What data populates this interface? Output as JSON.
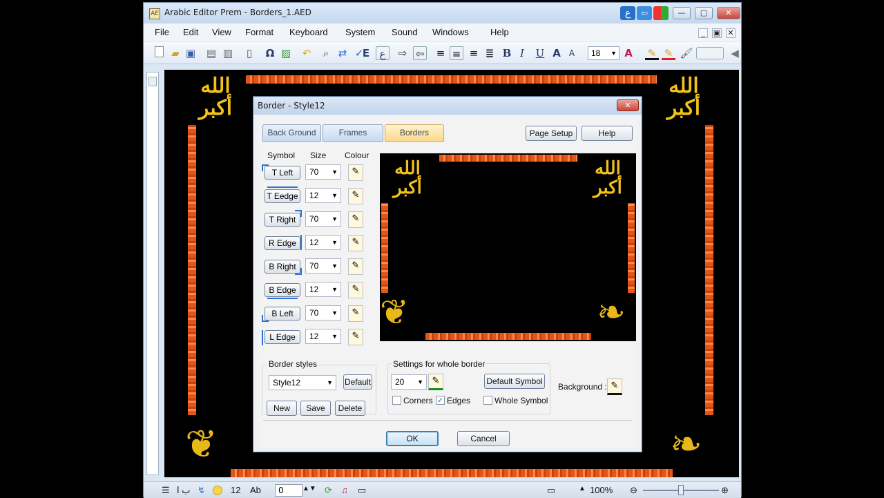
{
  "window": {
    "title": "Arabic Editor Prem - Borders_1.AED",
    "arabic_btn": "ع",
    "minimize": "—",
    "maximize": "▢",
    "close": "✕"
  },
  "menu": [
    "File",
    "Edit",
    "View",
    "Format",
    "Keyboard",
    "System",
    "Sound",
    "Windows",
    "Help"
  ],
  "toolbar": {
    "icons": [
      "new-icon",
      "open-icon",
      "save-icon",
      "print-icon",
      "print-preview-icon",
      "document-icon",
      "omega-icon",
      "image-icon",
      "undo-icon",
      "find-icon",
      "replace-icon",
      "spell-check-icon",
      "english-icon",
      "arabic-icon",
      "ltr-icon",
      "rtl-icon",
      "align-left-icon",
      "align-center-icon",
      "align-right-icon",
      "justify-icon",
      "bold-icon",
      "italic-icon",
      "underline-icon",
      "grow-font-icon",
      "shrink-font-icon"
    ],
    "glyphs": {
      "english": "E",
      "arabic": "ع",
      "bold": "B",
      "italic": "I",
      "underline": "U",
      "grow": "A",
      "shrink": "A",
      "font_colour": "A"
    },
    "font_size": "18"
  },
  "document": {
    "calligraphy": "الله أكبر"
  },
  "dialog": {
    "title": "Border - Style12",
    "close": "✕",
    "tabs": [
      {
        "label": "Back Ground",
        "active": false
      },
      {
        "label": "Frames",
        "active": false
      },
      {
        "label": "Borders",
        "active": true
      }
    ],
    "page_setup": "Page Setup",
    "help": "Help",
    "headers": {
      "symbol": "Symbol",
      "size": "Size",
      "colour": "Colour"
    },
    "rows": [
      {
        "symbol": "T Left",
        "size": "70"
      },
      {
        "symbol": "T Eedge",
        "size": "12"
      },
      {
        "symbol": "T Right",
        "size": "70"
      },
      {
        "symbol": "R Edge",
        "size": "12"
      },
      {
        "symbol": "B Right",
        "size": "70"
      },
      {
        "symbol": "B Edge",
        "size": "12"
      },
      {
        "symbol": "B Left",
        "size": "70"
      },
      {
        "symbol": "L Edge",
        "size": "12"
      }
    ],
    "border_styles": {
      "label": "Border styles",
      "selected": "Style12",
      "default": "Default",
      "new": "New",
      "save": "Save",
      "delete": "Delete"
    },
    "whole": {
      "label": "Settings for whole border",
      "size": "20",
      "default_symbol": "Default Symbol",
      "corners": {
        "label": "Corners",
        "checked": false
      },
      "edges": {
        "label": "Edges",
        "checked": true
      },
      "whole_symbol": {
        "label": "Whole Symbol",
        "checked": false
      }
    },
    "background_label": "Background :",
    "ok": "OK",
    "cancel": "Cancel"
  },
  "status": {
    "lang": "ب ا",
    "font_size": "12",
    "ab": "Ab",
    "field": "0",
    "zoom": "100%",
    "zoom_level": 0.5
  },
  "colors": {
    "gold": "#f2c21a",
    "orange": "#e5541b",
    "accent_tab": "#fbd98a"
  }
}
